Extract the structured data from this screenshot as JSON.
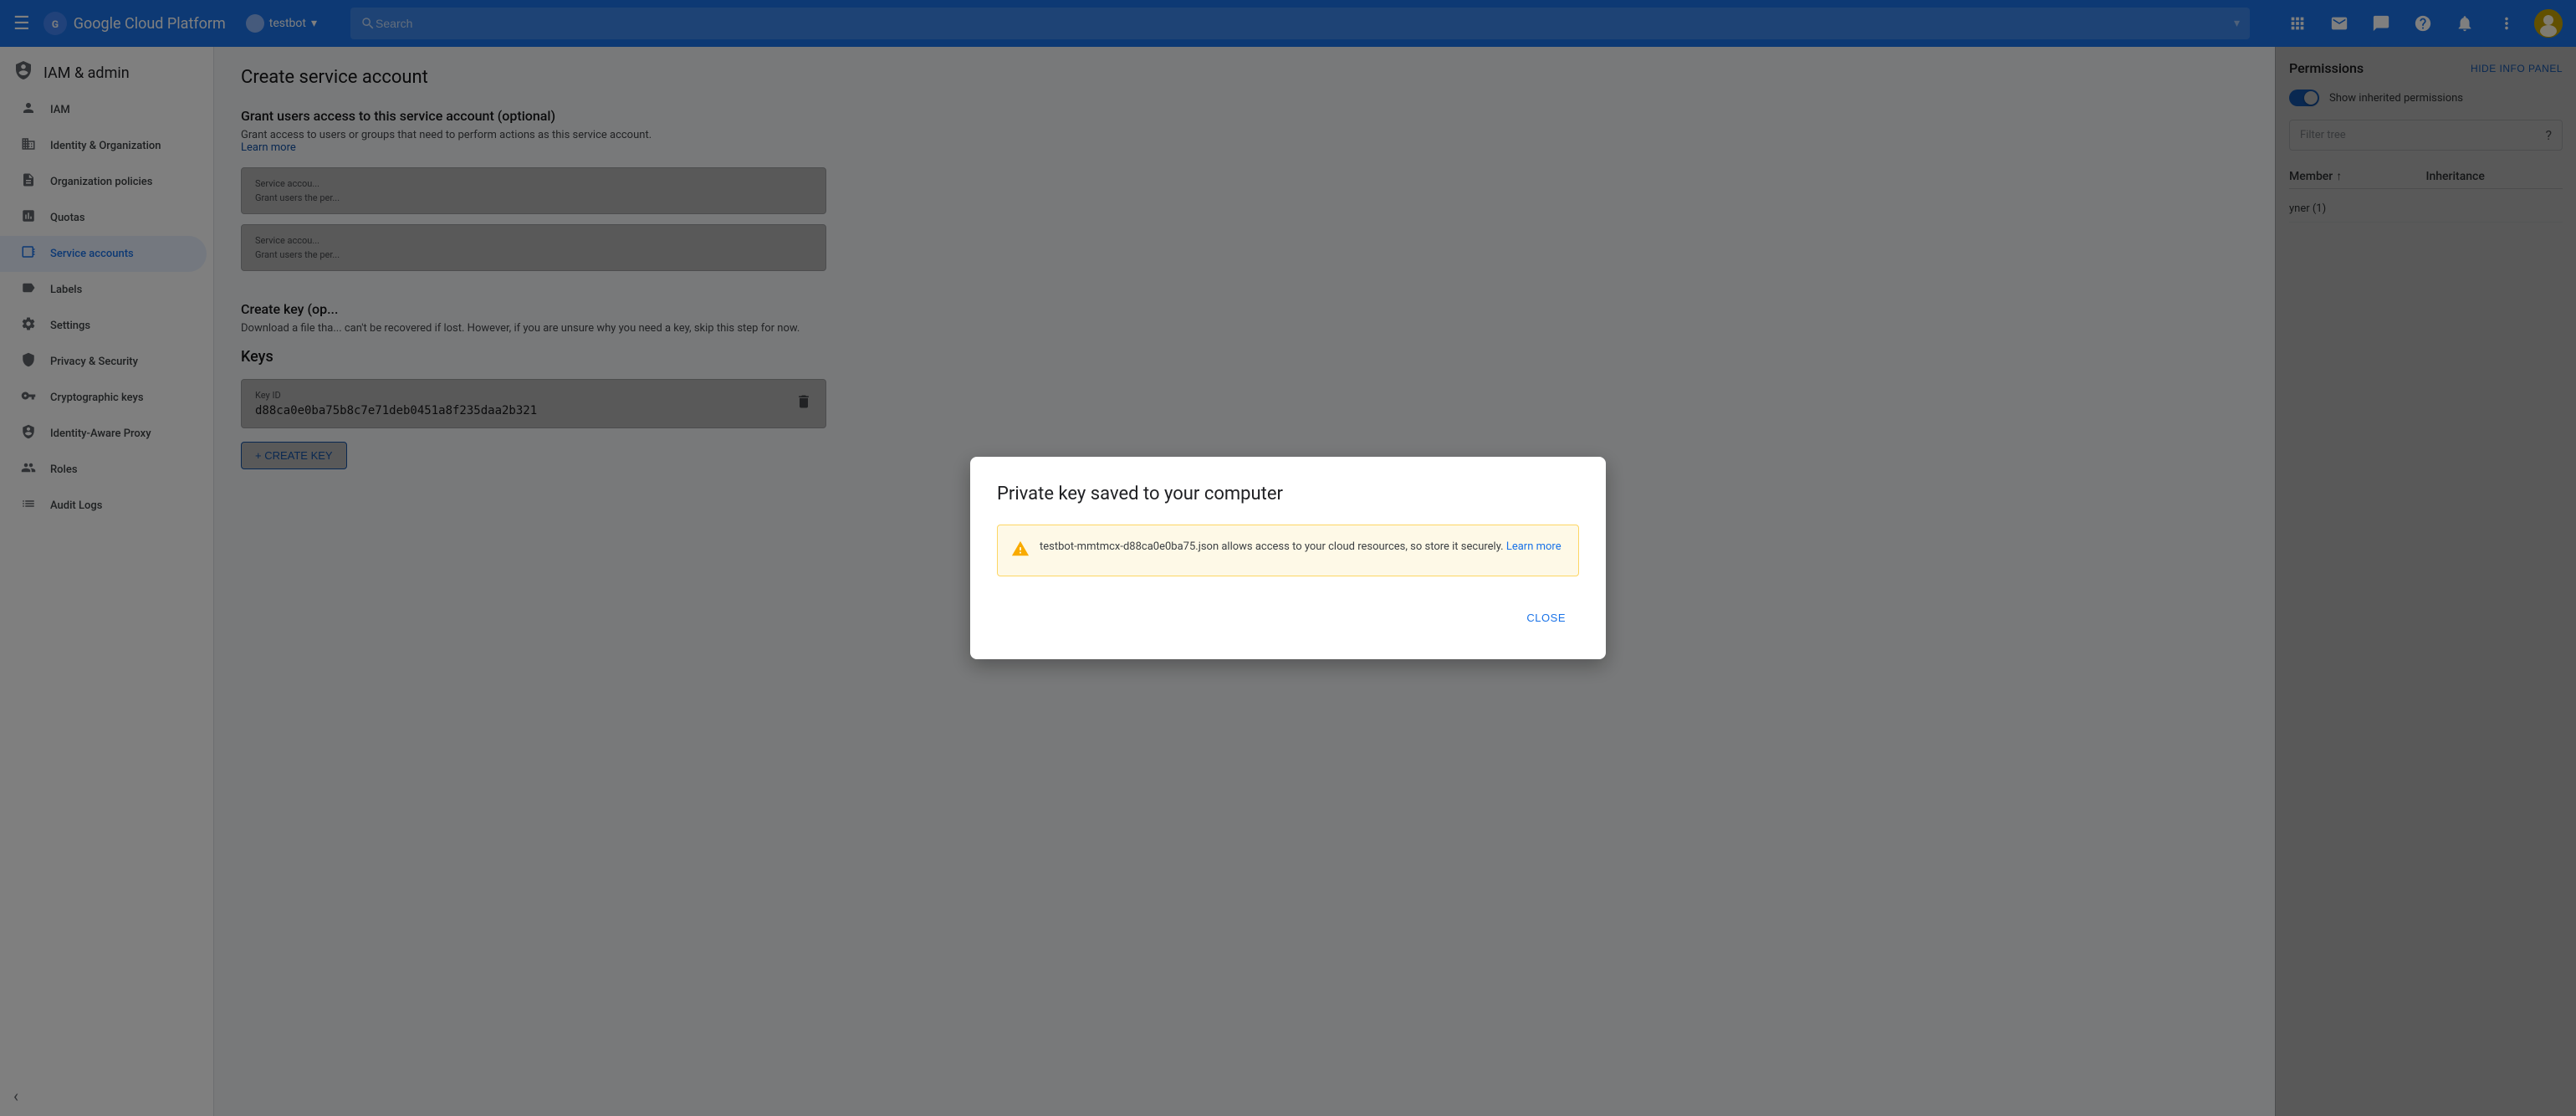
{
  "topnav": {
    "hamburger": "☰",
    "logo": "Google Cloud Platform",
    "project_name": "testbot",
    "search_placeholder": "Search",
    "hide_panel_label": "HIDE INFO PANEL"
  },
  "sidebar": {
    "header_title": "IAM & admin",
    "items": [
      {
        "id": "iam",
        "label": "IAM",
        "icon": "👤"
      },
      {
        "id": "identity-org",
        "label": "Identity & Organization",
        "icon": "🏢"
      },
      {
        "id": "org-policies",
        "label": "Organization policies",
        "icon": "📄"
      },
      {
        "id": "quotas",
        "label": "Quotas",
        "icon": "📊"
      },
      {
        "id": "service-accounts",
        "label": "Service accounts",
        "icon": "🔧",
        "active": true
      },
      {
        "id": "labels",
        "label": "Labels",
        "icon": "🏷"
      },
      {
        "id": "settings",
        "label": "Settings",
        "icon": "⚙"
      },
      {
        "id": "privacy-security",
        "label": "Privacy & Security",
        "icon": "🛡"
      },
      {
        "id": "cryptographic-keys",
        "label": "Cryptographic keys",
        "icon": "🔑"
      },
      {
        "id": "identity-aware-proxy",
        "label": "Identity-Aware Proxy",
        "icon": "🛡"
      },
      {
        "id": "roles",
        "label": "Roles",
        "icon": "👥"
      },
      {
        "id": "audit-logs",
        "label": "Audit Logs",
        "icon": "📋"
      }
    ],
    "collapse_icon": "‹"
  },
  "main": {
    "page_title": "Create service account",
    "section1": {
      "title": "Grant users access to this service account (optional)",
      "description": "Grant access to users or groups that need to perform actions as this service account.",
      "learn_more": "Learn more"
    },
    "form_field1": {
      "label": "Service accou...",
      "helper": "Grant users the per..."
    },
    "form_field2": {
      "label": "Service accou...",
      "helper": "Grant users the per..."
    },
    "section2": {
      "title": "Create key (op...",
      "description": "Download a file tha... can't be recovered if lost. However, if you are unsure why you need a key, skip this step for now."
    },
    "keys_section": {
      "title": "Keys",
      "key_id_label": "Key ID",
      "key_id_value": "d88ca0e0ba75b8c7e71deb0451a8f235daa2b321",
      "create_key_btn": "+ CREATE KEY"
    }
  },
  "right_panel": {
    "title": "Permissions",
    "hide_label": "HIDE INFO PANEL",
    "toggle_label": "Show inherited permissions",
    "filter_placeholder": "Filter tree",
    "filter_help": "?",
    "table_headers": [
      {
        "label": "Member",
        "sort_icon": "↑"
      },
      {
        "label": "Inheritance"
      }
    ],
    "table_rows": [
      {
        "member": "yner (1)",
        "inheritance": ""
      }
    ]
  },
  "dialog": {
    "title": "Private key saved to your computer",
    "warning_text": "testbot-mmtmcx-d88ca0e0ba75.json allows access to your cloud resources, so store it securely.",
    "learn_more_label": "Learn more",
    "learn_more_url": "#",
    "close_btn_label": "CLOSE"
  },
  "colors": {
    "primary": "#1a73e8",
    "sidebar_active_bg": "#e8f0fe",
    "sidebar_active_text": "#1a73e8",
    "warning_bg": "#fef9e7",
    "warning_border": "#fdd663",
    "warning_icon": "#f9ab00"
  }
}
